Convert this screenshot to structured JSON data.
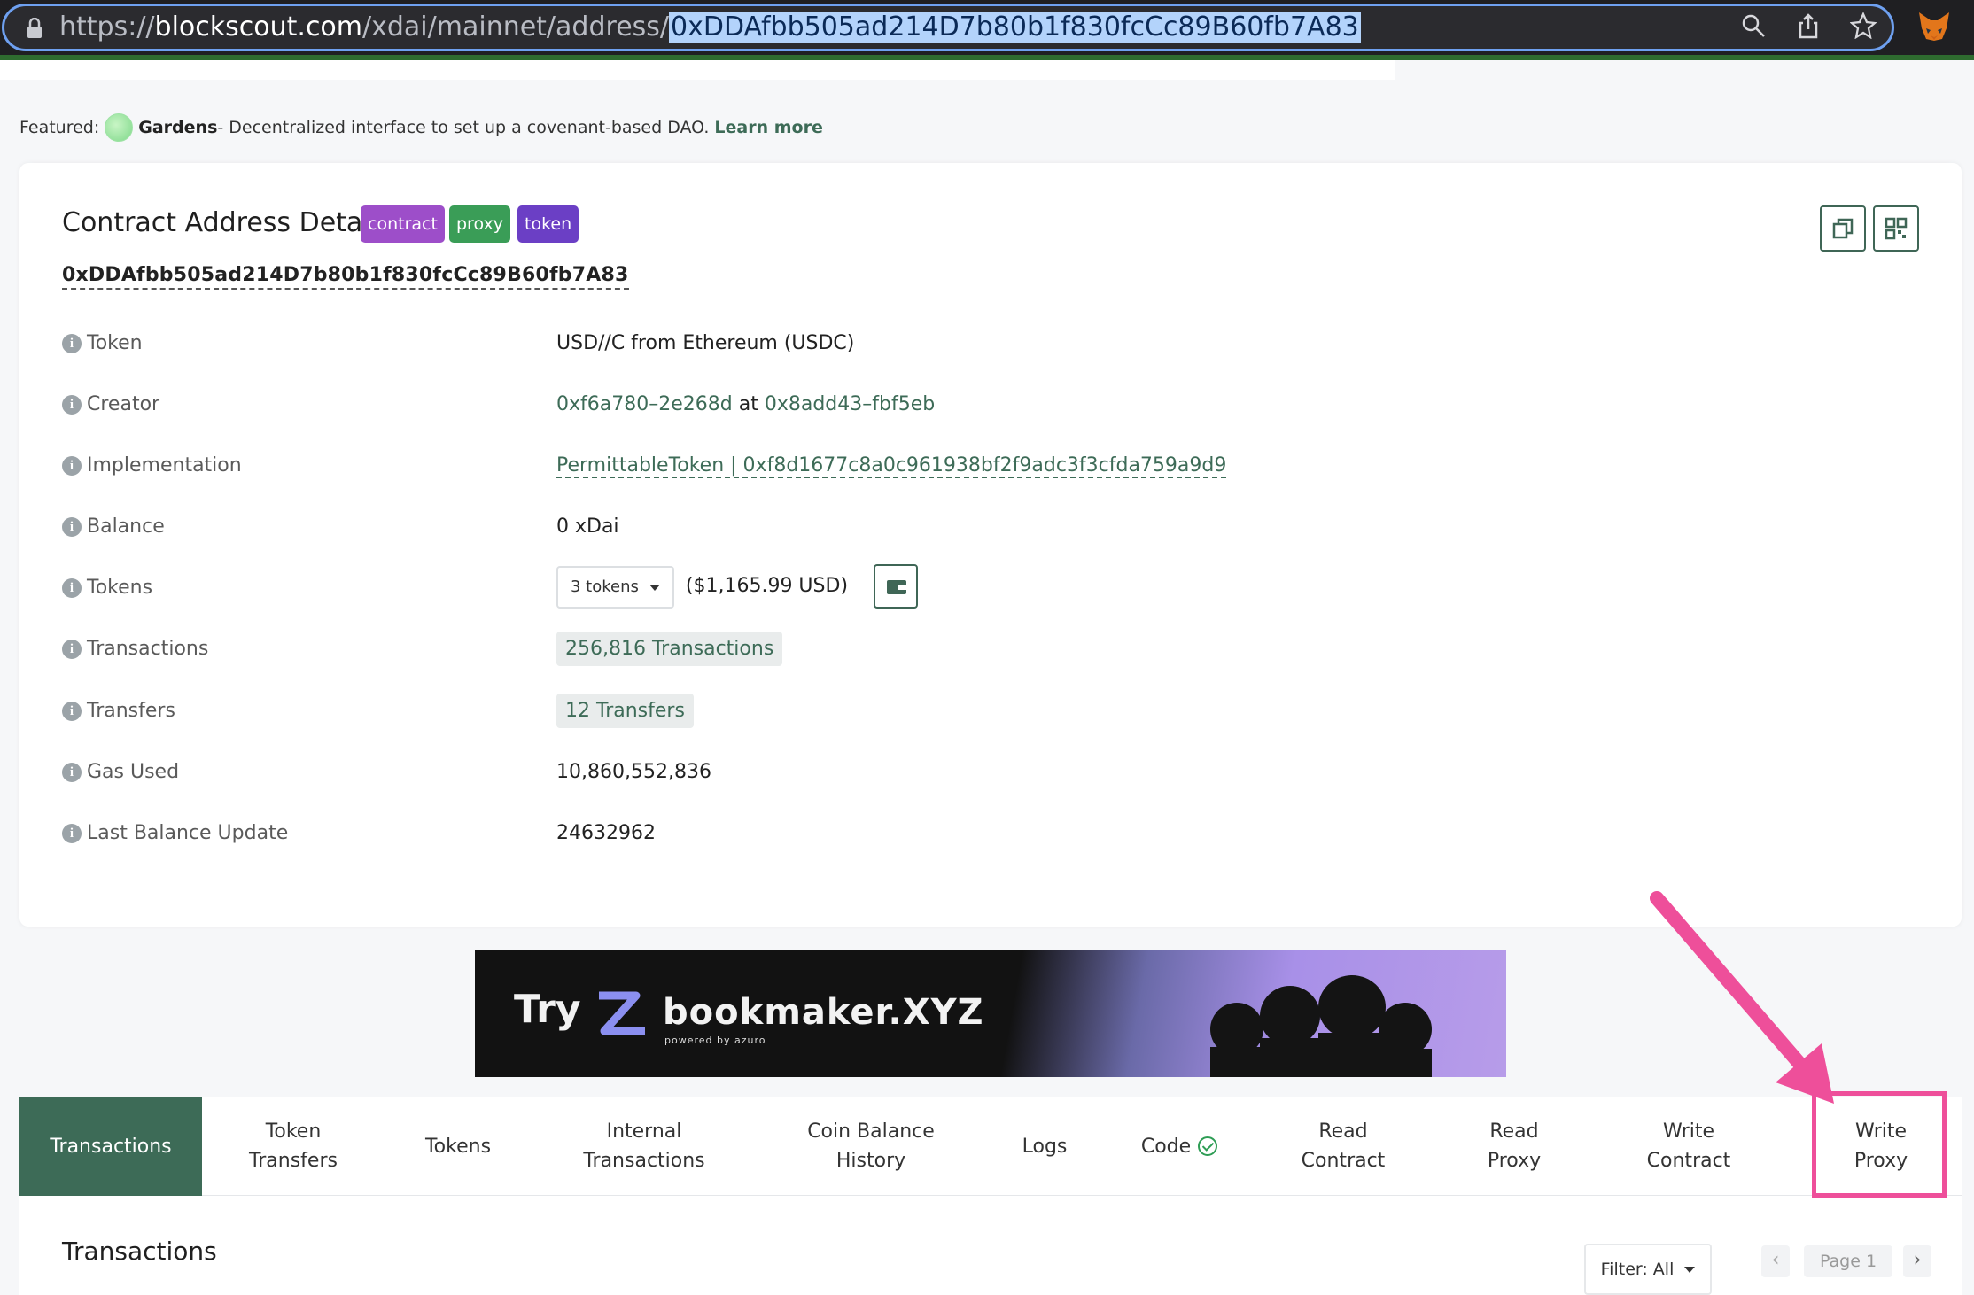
{
  "browser": {
    "url_prefix": "https://",
    "url_host": "blockscout.com",
    "url_path": "/xdai/mainnet/address/",
    "url_selected": "0xDDAfbb505ad214D7b80b1f830fcCc89B60fb7A83",
    "icons": [
      "lock-icon",
      "zoom-icon",
      "share-icon",
      "star-icon",
      "metamask-fox-icon"
    ]
  },
  "featured": {
    "prefix": "Featured:",
    "name": "Gardens",
    "text": " - Decentralized interface to set up a covenant-based DAO.",
    "link": "Learn more"
  },
  "card": {
    "title": "Contract Address Details",
    "badges": [
      {
        "label": "contract",
        "color": "#9d4ec9"
      },
      {
        "label": "proxy",
        "color": "#3a9d57"
      },
      {
        "label": "token",
        "color": "#6b3fc5"
      }
    ],
    "address": "0xDDAfbb505ad214D7b80b1f830fcCc89B60fb7A83",
    "rows": {
      "token": {
        "label": "Token",
        "value": "USD//C from Ethereum (USDC)"
      },
      "creator": {
        "label": "Creator",
        "value_a": "0xf6a780–2e268d",
        "at": " at ",
        "value_b": "0x8add43–fbf5eb"
      },
      "implementation": {
        "label": "Implementation",
        "value": "PermittableToken | 0xf8d1677c8a0c961938bf2f9adc3f3cfda759a9d9"
      },
      "balance": {
        "label": "Balance",
        "value": "0 xDai"
      },
      "tokens": {
        "label": "Tokens",
        "dropdown": "3 tokens",
        "usd": "($1,165.99 USD)"
      },
      "transactions": {
        "label": "Transactions",
        "value": "256,816 Transactions"
      },
      "transfers": {
        "label": "Transfers",
        "value": "12 Transfers"
      },
      "gas": {
        "label": "Gas Used",
        "value": "10,860,552,836"
      },
      "last_update": {
        "label": "Last Balance Update",
        "value": "24632962"
      }
    }
  },
  "banner": {
    "try": "Try",
    "brand": "bookmaker.XYZ",
    "powered": "powered by azuro"
  },
  "tabs": [
    {
      "line1": "Transactions",
      "line2": ""
    },
    {
      "line1": "Token",
      "line2": "Transfers"
    },
    {
      "line1": "Tokens",
      "line2": ""
    },
    {
      "line1": "Internal",
      "line2": "Transactions"
    },
    {
      "line1": "Coin Balance",
      "line2": "History"
    },
    {
      "line1": "Logs",
      "line2": ""
    },
    {
      "line1": "Code",
      "line2": ""
    },
    {
      "line1": "Read",
      "line2": "Contract"
    },
    {
      "line1": "Read",
      "line2": "Proxy"
    },
    {
      "line1": "Write",
      "line2": "Contract"
    },
    {
      "line1": "Write",
      "line2": "Proxy"
    }
  ],
  "section": {
    "title": "Transactions",
    "filter": "Filter: All",
    "page": "Page 1",
    "prev": "‹",
    "next": "›"
  },
  "colors": {
    "accent": "#3d6b57",
    "annotation": "#ee4f9a"
  }
}
